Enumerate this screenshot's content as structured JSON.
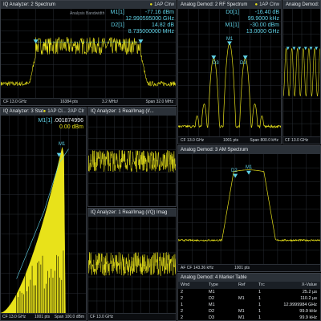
{
  "colors": {
    "trace": "#e8e21a",
    "marker": "#5fd1e6",
    "grid": "#2a2f36",
    "titlebar": "#2b3138"
  },
  "w1": {
    "title": "IQ Analyzer: 2 Spectrum",
    "icons": "1AP Clrw",
    "annotation": "Analysis Bandwidth",
    "m1_label": "M1[1]",
    "m1_value": "-77.16 dBm",
    "m1_freq": "12.990595000 GHz",
    "d2_label": "D2[1]",
    "d2_value": "14.82 dB",
    "d2_freq": "8.735000000 MHz",
    "footer": {
      "left": "CF 13.0 GHz",
      "mid": "16384 pts",
      "mid2": "3.2 MHz/",
      "right": "Span 32.0 MHz"
    }
  },
  "w2": {
    "title": "Analog Demod: 2 RF Spectrum",
    "icons": "1AP Clrw",
    "d0_label": "D0[1]",
    "d0_value": "-16.40 dB",
    "d0_freq": "99.9000 kHz",
    "m1_label": "M1[1]",
    "m1_value": "-30.00 dBm",
    "m1_freq": "13.0000 GHz",
    "footer": {
      "left": "CF 13.0 GHz",
      "mid": "1001 pts",
      "right": "Span 800.0 kHz"
    }
  },
  "w3": {
    "title": "Analog Demod: 1 ...",
    "footer": {
      "left": "CF 13.0 GHz"
    }
  },
  "w4": {
    "title": "IQ Analyzer: 3 Stat",
    "icons": "1AP Cl... 2AP Clr",
    "m1_label": "M1[1]",
    "m1_value": ".001874996",
    "m1_sub": "0.00 dBm",
    "footer": {
      "left": "CF 13.0 GHz",
      "mid": "1001 pts",
      "right": "Span 100.0 dBm"
    }
  },
  "w5": {
    "title": "IQ Analyzer: 1 Real/Imag (I/...",
    "icons": "1AP Clrw",
    "footer": {
      "left": "",
      "right": ""
    }
  },
  "w6": {
    "title": "IQ Analyzer: 1 Real/Imag (I/Q) Imag",
    "icons": "1AP Clrw",
    "footer": {
      "left": "CF 13.0 GHz",
      "right": ""
    }
  },
  "w7": {
    "title": "Analog Demod: 3 AM Spectrum",
    "footer": {
      "left": "AF CF 143.36 kHz",
      "mid": "1001 pts"
    }
  },
  "w8": {
    "title": "Analog Demod: 4 Marker Table",
    "headers": [
      "Wnd",
      "Type",
      "Ref",
      "Trc",
      "X-Value"
    ],
    "rows": [
      [
        "2",
        "M1",
        "",
        "1",
        "25.2 µs"
      ],
      [
        "2",
        "D2",
        "M1",
        "1",
        "110.2 µs"
      ],
      [
        "1",
        "M1",
        "",
        "1",
        "12.9999984 GHz"
      ],
      [
        "2",
        "D2",
        "M1",
        "1",
        "99.9 kHz"
      ],
      [
        "2",
        "D3",
        "M1",
        "1",
        "99.9 kHz"
      ]
    ]
  }
}
